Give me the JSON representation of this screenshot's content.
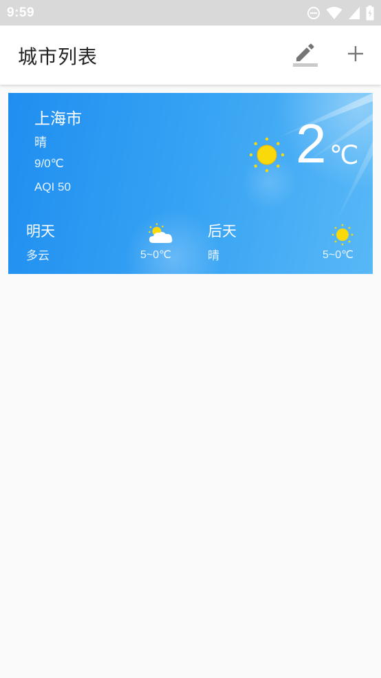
{
  "status_bar": {
    "time": "9:59",
    "icons": [
      "do-not-disturb-icon",
      "wifi-icon",
      "cell-signal-icon",
      "battery-icon"
    ]
  },
  "app_bar": {
    "title": "城市列表",
    "edit_icon": "edit-pencil-icon",
    "add_icon": "add-plus-icon"
  },
  "cities": [
    {
      "name": "上海市",
      "condition": "晴",
      "range": "9/0℃",
      "aqi": "AQI 50",
      "current_temp": "2",
      "temp_unit": "℃",
      "icon": "sun-icon",
      "forecast": [
        {
          "label": "明天",
          "condition": "多云",
          "range": "5~0℃",
          "icon": "partly-cloudy-icon"
        },
        {
          "label": "后天",
          "condition": "晴",
          "range": "5~0℃",
          "icon": "sun-icon"
        }
      ]
    }
  ],
  "colors": {
    "status_bar_bg": "#d9d9d9",
    "app_bar_bg": "#ffffff",
    "card_bg": "#2f9bf2",
    "sun": "#f9d90a",
    "icon_gray": "#757575"
  }
}
